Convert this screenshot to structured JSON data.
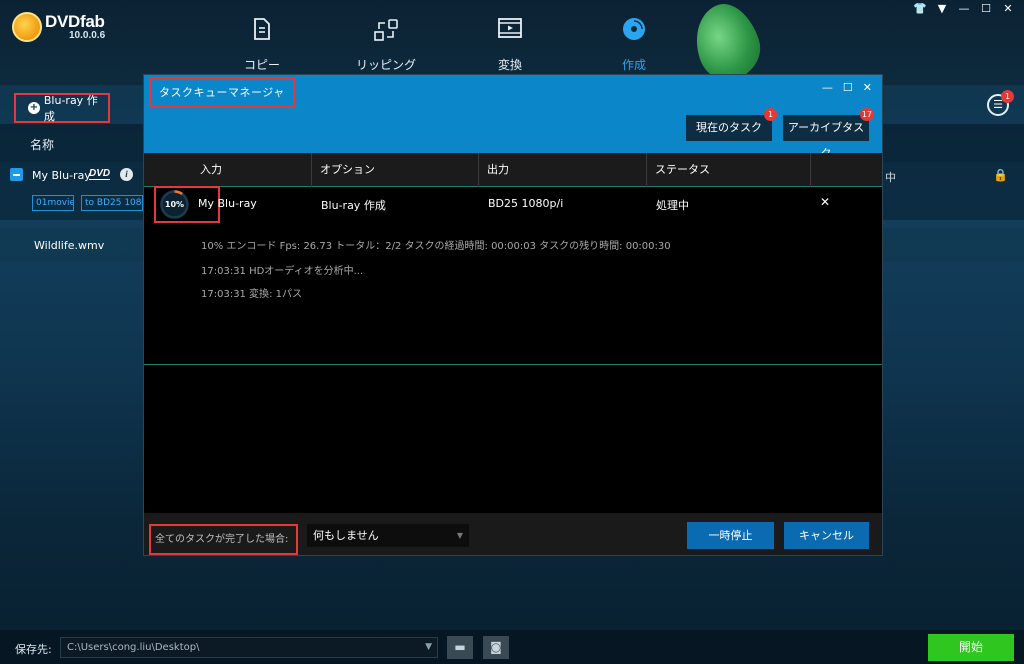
{
  "app": {
    "name": "DVDfab",
    "version": "10.0.0.6",
    "accent_color": "#0a86c9",
    "start_color": "#2ec61f",
    "highlight_color": "#e53935"
  },
  "nav": [
    {
      "label": "コピー",
      "icon": "copy-document-icon"
    },
    {
      "label": "リッピング",
      "icon": "rip-arrows-icon"
    },
    {
      "label": "変換",
      "icon": "film-icon"
    },
    {
      "label": "作成",
      "icon": "disc-icon",
      "active": true
    }
  ],
  "window_controls": [
    "👕",
    "▼",
    "—",
    "☐",
    "✕"
  ],
  "left": {
    "mode_button": "Blu-ray 作成",
    "column_name": "名称",
    "row1": {
      "title": "My Blu-ray",
      "badge": "DVD",
      "info": "i",
      "tags": [
        "01movie",
        "to BD25 1080"
      ],
      "status_partial": "中"
    },
    "row2": {
      "title": "Wildlife.wmv"
    },
    "queue_icon_badge": "1"
  },
  "dialog": {
    "title": "タスクキューマネージャ",
    "controls": [
      "—",
      "☐",
      "✕"
    ],
    "tabs": [
      {
        "label": "現在のタスク",
        "badge": "1"
      },
      {
        "label": "アーカイブタスク",
        "badge": "17"
      }
    ],
    "columns": [
      "入力",
      "オプション",
      "出力",
      "ステータス"
    ],
    "task": {
      "progress_label": "10%",
      "progress_fraction": 0.1,
      "input": "My Blu-ray",
      "option": "Blu-ray 作成",
      "output": "BD25 1080p/i",
      "status": "処理中",
      "close": "✕"
    },
    "log": [
      "10%  エンコード Fps: 26.73  トータル：2/2  タスクの経過時間: 00:00:03  タスクの残り時間: 00:00:30",
      "17:03:31    HDオーディオを分析中...",
      "17:03:31    変換: 1パス"
    ],
    "footer": {
      "when_done_label": "全てのタスクが完了した場合:",
      "when_done_value": "何もしません",
      "pause": "一時停止",
      "cancel": "キャンセル"
    }
  },
  "bottom": {
    "save_label": "保存先:",
    "path": "C:\\Users\\cong.liu\\Desktop\\",
    "start": "開始"
  }
}
